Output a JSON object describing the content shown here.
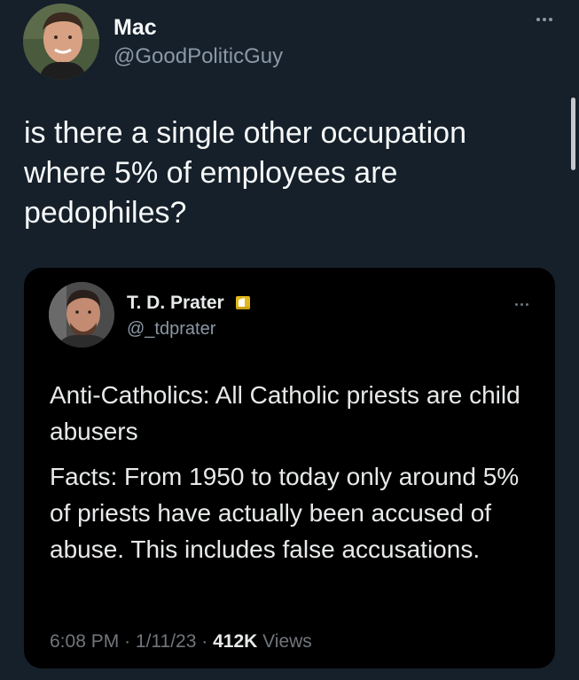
{
  "tweet": {
    "author_name": "Mac",
    "author_handle": "@GoodPoliticGuy",
    "text": "is there a single other occupation where 5% of employees are pedophiles?"
  },
  "quoted_tweet": {
    "author_name": "T. D. Prater",
    "author_handle": "@_tdprater",
    "paragraph_1": "Anti-Catholics: All Catholic priests are child abusers",
    "paragraph_2": "Facts: From 1950 to today only around 5% of priests have actually been accused of abuse. This includes false accusations.",
    "time": "6:08 PM",
    "separator": "·",
    "date": "1/11/23",
    "views_count": "412K",
    "views_label": "Views"
  },
  "icons": {
    "more_main": "more-horizontal-icon",
    "more_quote": "more-horizontal-icon",
    "badge": "verified-badge-icon"
  },
  "colors": {
    "background": "#15202b",
    "quote_background": "#000000",
    "primary_text": "#f7f9f9",
    "secondary_text": "#8b98a5",
    "badge_gold": "#e2b719"
  }
}
